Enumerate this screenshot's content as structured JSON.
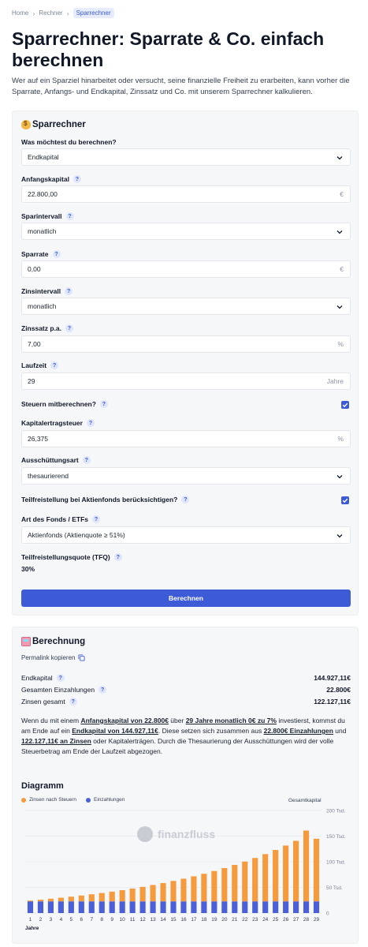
{
  "breadcrumb": {
    "home": "Home",
    "rechner": "Rechner",
    "current": "Sparrechner"
  },
  "page": {
    "title": "Sparrechner: Sparrate & Co. einfach berechnen",
    "intro": "Wer auf ein Sparziel hinarbeitet oder versucht, seine finanzielle Freiheit zu erarbeiten, kann vorher die Sparrate, Anfangs- und Endkapital, Zinssatz und Co. mit unserem Sparrechner kalkulieren."
  },
  "form": {
    "title": "Sparrechner",
    "mode_label": "Was möchtest du berechnen?",
    "mode_value": "Endkapital",
    "start_label": "Anfangskapital",
    "start_value": "22.800,00",
    "start_unit": "€",
    "interval_label": "Sparintervall",
    "interval_value": "monatlich",
    "rate_label": "Sparrate",
    "rate_value": "0,00",
    "rate_unit": "€",
    "zinsint_label": "Zinsintervall",
    "zinsint_value": "monatlich",
    "zins_label": "Zinssatz p.a.",
    "zins_value": "7,00",
    "zins_unit": "%",
    "laufzeit_label": "Laufzeit",
    "laufzeit_value": "29",
    "laufzeit_unit": "Jahre",
    "steuern_label": "Steuern mitberechnen?",
    "steuern_checked": true,
    "kest_label": "Kapitalertragsteuer",
    "kest_value": "26,375",
    "kest_unit": "%",
    "ausschuettung_label": "Ausschüttungsart",
    "ausschuettung_value": "thesaurierend",
    "teilfrei_label": "Teilfreistellung bei Aktienfonds berücksichtigen?",
    "teilfrei_checked": true,
    "fondsart_label": "Art des Fonds / ETFs",
    "fondsart_value": "Aktienfonds (Aktienquote ≥ 51%)",
    "tfq_label": "Teilfreistellungsquote (TFQ)",
    "tfq_value": "30%",
    "submit_label": "Berechnen",
    "help_glyph": "?"
  },
  "result": {
    "title": "Berechnung",
    "permalink": "Permalink kopieren",
    "endkapital_label": "Endkapital",
    "endkapital_value": "144.927,11€",
    "einzahlungen_label": "Gesamten Einzahlungen",
    "einzahlungen_value": "22.800€",
    "zinsen_label": "Zinsen gesamt",
    "zinsen_value": "122.127,11€",
    "summary": {
      "t1": "Wenn du mit einem ",
      "b1": "Anfangskapital von 22.800€",
      "t2": " über ",
      "b2": "29 Jahre monatlich 0€ zu 7%",
      "t3": " investierst, kommst du am Ende auf ein ",
      "b3": "Endkapital von 144.927,11€",
      "t4": ". Diese setzen sich zusammen aus ",
      "b4": "22.800€ Einzahlungen",
      "t5": " und ",
      "b5": "122.127,11€ an Zinsen",
      "t6": " oder Kapitalerträgen. Durch die Thesaurierung der Ausschüttungen wird der volle Steuerbetrag am Ende der Laufzeit abgezogen."
    }
  },
  "chart_data": {
    "type": "bar",
    "title": "Diagramm",
    "xlabel": "Jahre",
    "ylabel": "Gesamtkapital",
    "watermark": "finanzfluss",
    "stacked": true,
    "ylim": [
      0,
      200
    ],
    "yticks": [
      "0",
      "50 Tsd.",
      "100 Tsd.",
      "150 Tsd.",
      "200 Tsd."
    ],
    "categories": [
      "1",
      "2",
      "3",
      "4",
      "5",
      "6",
      "7",
      "8",
      "9",
      "10",
      "11",
      "12",
      "13",
      "14",
      "15",
      "16",
      "17",
      "18",
      "19",
      "20",
      "21",
      "22",
      "23",
      "24",
      "25",
      "26",
      "27",
      "28",
      "29"
    ],
    "series": [
      {
        "name": "Einzahlungen",
        "color": "#4a5fd8",
        "values": [
          22.8,
          22.8,
          22.8,
          22.8,
          22.8,
          22.8,
          22.8,
          22.8,
          22.8,
          22.8,
          22.8,
          22.8,
          22.8,
          22.8,
          22.8,
          22.8,
          22.8,
          22.8,
          22.8,
          22.8,
          22.8,
          22.8,
          22.8,
          22.8,
          22.8,
          22.8,
          22.8,
          22.8,
          22.8
        ]
      },
      {
        "name": "Zinsen nach Steuern",
        "color": "#f59a3d",
        "values": [
          1.6,
          3.3,
          5.2,
          7.1,
          9.2,
          11.4,
          13.8,
          16.3,
          19.0,
          21.9,
          25.0,
          28.3,
          31.9,
          35.7,
          39.8,
          44.2,
          48.8,
          53.8,
          59.2,
          64.9,
          71.0,
          77.6,
          84.6,
          92.1,
          100.2,
          108.8,
          118.0,
          138.0,
          122.1
        ]
      }
    ],
    "grid": true,
    "legend": "top-left"
  }
}
